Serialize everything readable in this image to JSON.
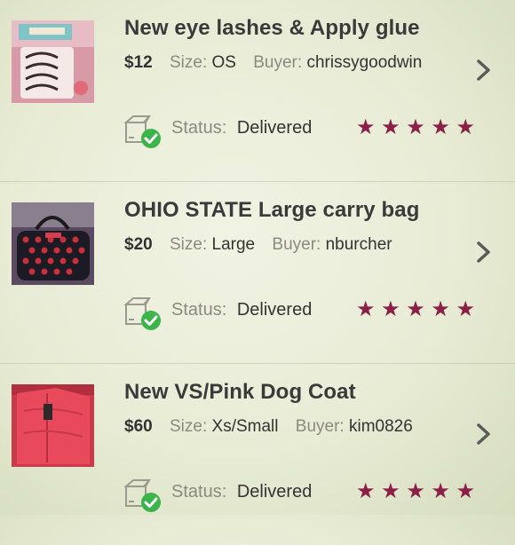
{
  "orders": [
    {
      "title": "New eye lashes & Apply glue",
      "price": "$12",
      "size_label": "Size:",
      "size": "OS",
      "buyer_label": "Buyer:",
      "buyer": "chrissygoodwin",
      "status_label": "Status:",
      "status": "Delivered",
      "rating": 5,
      "image": "eyelashes-photo"
    },
    {
      "title": "OHIO STATE Large carry bag",
      "price": "$20",
      "size_label": "Size:",
      "size": "Large",
      "buyer_label": "Buyer:",
      "buyer": "nburcher",
      "status_label": "Status:",
      "status": "Delivered",
      "rating": 5,
      "image": "bag-photo"
    },
    {
      "title": "New VS/Pink Dog Coat",
      "price": "$60",
      "size_label": "Size:",
      "size": "Xs/Small",
      "buyer_label": "Buyer:",
      "buyer": "kim0826",
      "status_label": "Status:",
      "status": "Delivered",
      "rating": 5,
      "image": "dog-coat-photo"
    }
  ],
  "colors": {
    "star": "#8c1f47",
    "check": "#3bb54a",
    "title": "#3a3a3a",
    "label": "#8a8a80"
  },
  "icons": {
    "chevron": "chevron-right-icon",
    "package": "package-delivered-icon",
    "star": "star-icon"
  }
}
